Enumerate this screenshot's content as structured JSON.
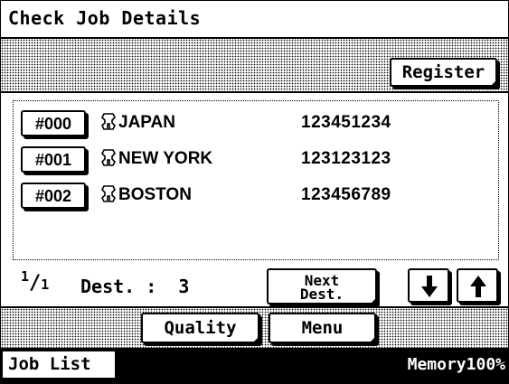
{
  "header": {
    "title": "Check Job Details"
  },
  "toolbar": {
    "register_label": "Register"
  },
  "destinations": [
    {
      "code": "#000",
      "name": "JAPAN",
      "number": "123451234"
    },
    {
      "code": "#001",
      "name": "NEW YORK",
      "number": "123123123"
    },
    {
      "code": "#002",
      "name": "BOSTON",
      "number": "123456789"
    }
  ],
  "pager": {
    "current_page": "1",
    "total_pages": "1",
    "dest_text": "Dest. :  3",
    "next_dest_line1": "Next",
    "next_dest_line2": "Dest."
  },
  "bottom": {
    "quality_label": "Quality",
    "menu_label": "Menu"
  },
  "status": {
    "job_list_label": "Job List",
    "memory_text": "Memory100%"
  },
  "icons": {
    "contact": "keyhole-contact-icon",
    "down": "arrow-down-icon",
    "up": "arrow-up-icon"
  }
}
